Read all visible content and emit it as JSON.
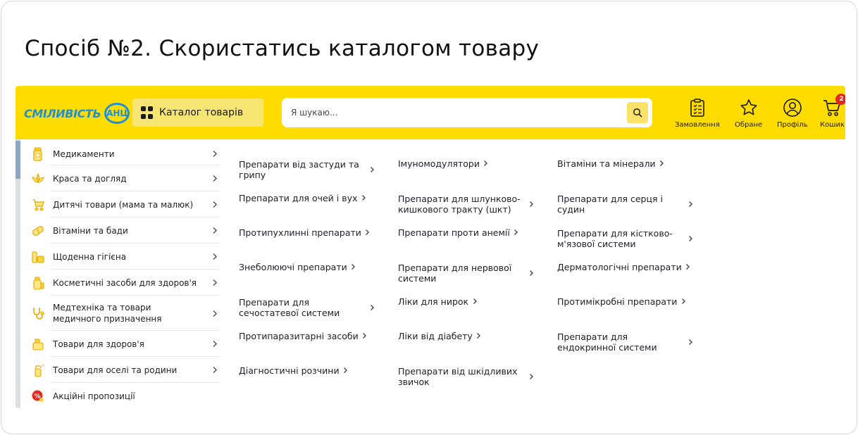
{
  "slide": {
    "title": "Спосіб №2. Скористатись каталогом товару"
  },
  "header": {
    "logo_text": "СМІЛИВІСТЬ",
    "logo_badge": "АНЦ",
    "catalog_label": "Каталог товарів",
    "search_placeholder": "Я шукаю...",
    "actions": [
      {
        "label": "Замовлення",
        "icon": "clipboard-list-icon"
      },
      {
        "label": "Обране",
        "icon": "star-icon"
      },
      {
        "label": "Профіль",
        "icon": "user-circle-icon"
      },
      {
        "label": "Кошик",
        "icon": "cart-icon",
        "badge": "2"
      }
    ],
    "colors": {
      "bar": "#ffdc00",
      "brand_blue": "#1f8fd6",
      "badge_red": "#e5281f"
    }
  },
  "sidebar": {
    "items": [
      {
        "label": "Медикаменти",
        "icon": "medicine-bottle-icon"
      },
      {
        "label": "Краса та догляд",
        "icon": "lotus-icon"
      },
      {
        "label": "Дитячі товари (мама та малюк)",
        "icon": "stroller-icon"
      },
      {
        "label": "Вітаміни та бади",
        "icon": "pill-icon"
      },
      {
        "label": "Щоденна гігієна",
        "icon": "hygiene-icon"
      },
      {
        "label": "Косметичні засоби для здоров'я",
        "icon": "cream-tube-icon"
      },
      {
        "label": "Медтехніка та товари медичного призначення",
        "icon": "stethoscope-icon"
      },
      {
        "label": "Товари для здоров'я",
        "icon": "health-box-icon"
      },
      {
        "label": "Товари для оселі та родини",
        "icon": "spray-bottle-icon"
      },
      {
        "label": "Акційні пропозиції",
        "icon": "discount-badge-icon"
      }
    ]
  },
  "subcategories": {
    "columns": [
      [
        "Препарати від застуди та грипу",
        "Препарати для очей і вух",
        "Протипухлинні препарати",
        "Знеболюючі препарати",
        "Препарати для сечостатевої системи",
        "Протипаразитарні засоби",
        "Діагностичні розчини"
      ],
      [
        "Імуномодулятори",
        "Препарати для шлунково-кишкового тракту (шкт)",
        "Препарати проти анемії",
        "Препарати для нервової системи",
        "Ліки для нирок",
        "Ліки від діабету",
        "Препарати від шкідливих звичок"
      ],
      [
        "Вітаміни та мінерали",
        "Препарати для серця і судин",
        "Препарати для кістково-м'язової системи",
        "Дерматологічні препарати",
        "Протимікробні препарати",
        "Препарати для ендокринної системи"
      ]
    ]
  }
}
